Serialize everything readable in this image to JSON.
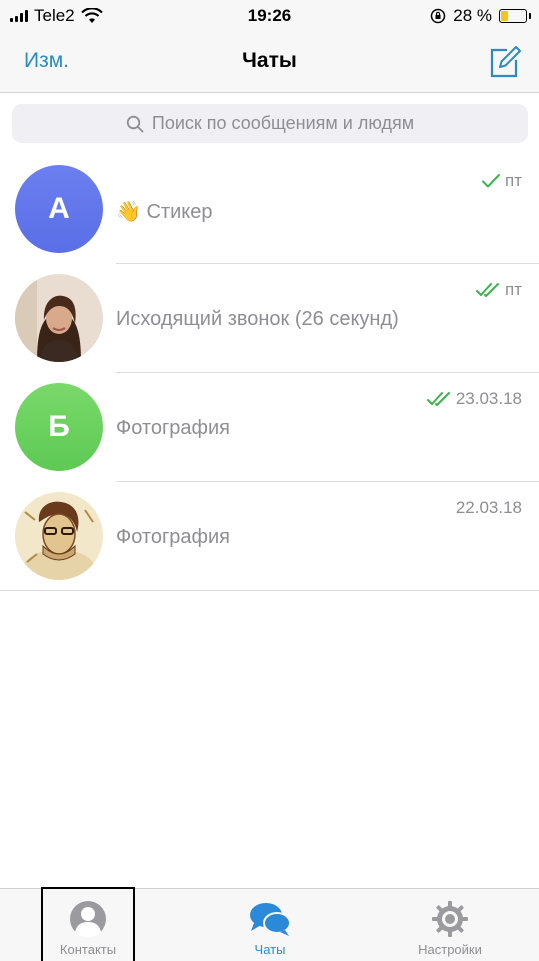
{
  "status_bar": {
    "carrier": "Tele2",
    "time": "19:26",
    "battery_percent": "28 %",
    "battery_level": 0.28
  },
  "nav": {
    "edit_label": "Изм.",
    "title": "Чаты",
    "compose_icon": "compose-icon"
  },
  "search": {
    "placeholder": "Поиск по сообщениям и людям"
  },
  "chats": [
    {
      "avatar_letter": "А",
      "avatar_color": "#5f72ea",
      "preview_emoji": "👋",
      "preview": "Стикер",
      "date": "пт",
      "status": "sent"
    },
    {
      "avatar_kind": "photo",
      "preview": "Исходящий звонок (26 секунд)",
      "date": "пт",
      "status": "read"
    },
    {
      "avatar_letter": "Б",
      "avatar_color": "#66cf5a",
      "preview": "Фотография",
      "date": "23.03.18",
      "status": "read"
    },
    {
      "avatar_kind": "photo",
      "preview": "Фотография",
      "date": "22.03.18",
      "status": "none"
    }
  ],
  "tabs": [
    {
      "label": "Контакты",
      "icon": "contacts-icon",
      "active": false
    },
    {
      "label": "Чаты",
      "icon": "chats-icon",
      "active": true
    },
    {
      "label": "Настройки",
      "icon": "settings-icon",
      "active": false
    }
  ],
  "colors": {
    "accent": "#2a8bbf",
    "check_green": "#3bb54a",
    "tab_active": "#2b89d9"
  }
}
